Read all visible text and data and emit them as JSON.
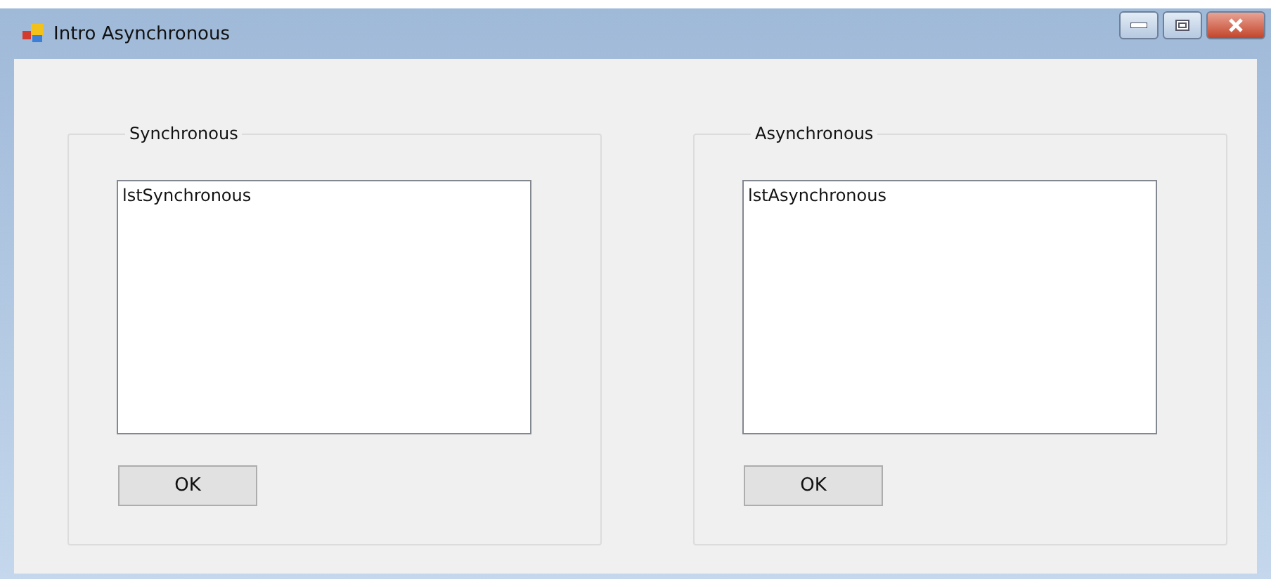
{
  "window": {
    "title": "Intro Asynchronous"
  },
  "groups": [
    {
      "title": "Synchronous",
      "list": {
        "items": [
          "lstSynchronous"
        ]
      },
      "button": "OK"
    },
    {
      "title": "Asynchronous",
      "list": {
        "items": [
          "lstAsynchronous"
        ]
      },
      "button": "OK"
    }
  ]
}
